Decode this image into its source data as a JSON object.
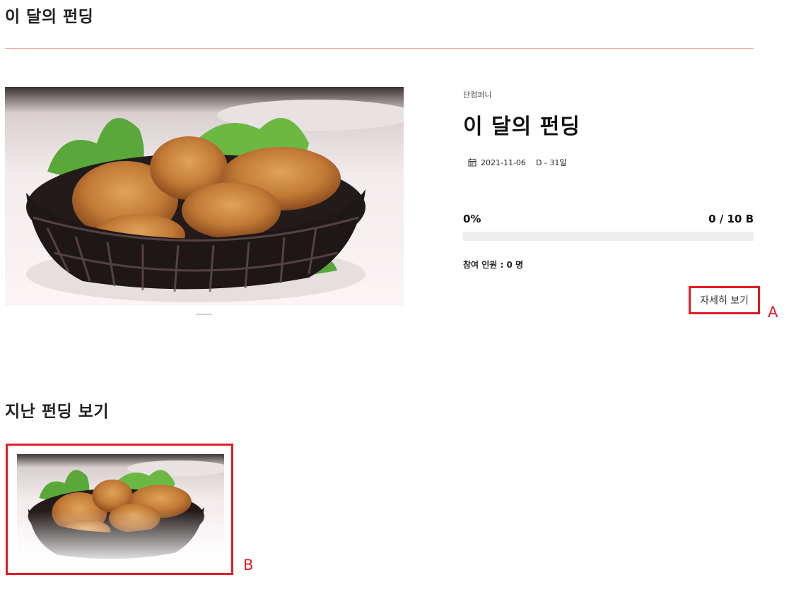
{
  "section": {
    "title": "이 달의 펀딩"
  },
  "featured": {
    "image_alt": "fried-chicken-basket",
    "company": "단컴퍼니",
    "title": "이 달의 펀딩",
    "date": "2021-11-06",
    "dday": "D - 31일",
    "percent": "0%",
    "progress_fraction": 0,
    "amount": "0 / 10 B",
    "participants": "참여 인원 : 0 명",
    "detail_button": "자세히 보기",
    "icon": "calendar-icon"
  },
  "annotations": {
    "a": "A",
    "b": "B"
  },
  "past": {
    "title": "지난 펀딩 보기"
  },
  "colors": {
    "accent": "#f06a4c",
    "divider": "#f2a596",
    "highlight": "#e21b25"
  }
}
